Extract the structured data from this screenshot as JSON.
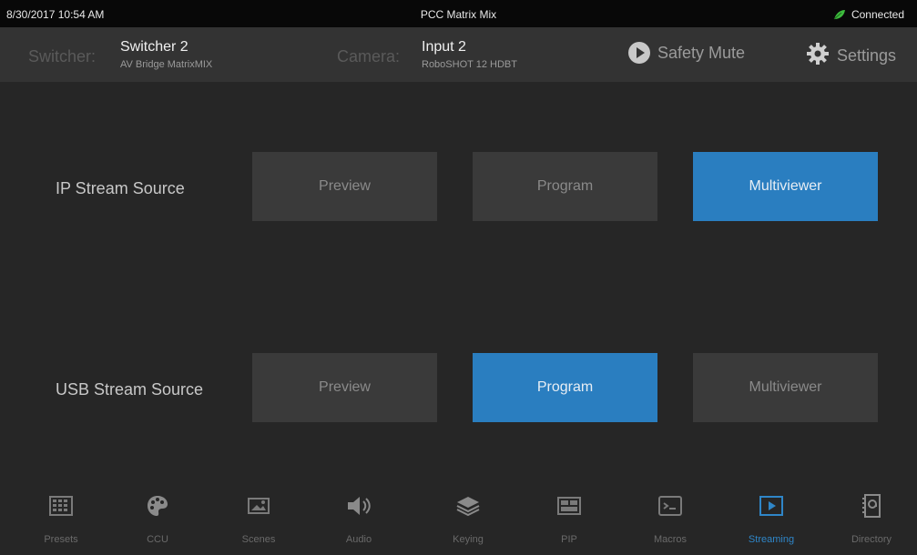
{
  "status": {
    "datetime": "8/30/2017 10:54 AM",
    "title": "PCC Matrix Mix",
    "connection": "Connected"
  },
  "header": {
    "switcher_label": "Switcher:",
    "switcher_name": "Switcher 2",
    "switcher_model": "AV Bridge MatrixMIX",
    "camera_label": "Camera:",
    "camera_name": "Input 2",
    "camera_model": "RoboSHOT 12 HDBT",
    "safety_mute": "Safety Mute",
    "settings": "Settings"
  },
  "rows": [
    {
      "label": "IP Stream Source",
      "options": [
        "Preview",
        "Program",
        "Multiviewer"
      ],
      "selected": "Multiviewer"
    },
    {
      "label": "USB Stream Source",
      "options": [
        "Preview",
        "Program",
        "Multiviewer"
      ],
      "selected": "Program"
    }
  ],
  "nav": [
    {
      "label": "Presets",
      "icon": "presets-grid-icon"
    },
    {
      "label": "CCU",
      "icon": "palette-icon"
    },
    {
      "label": "Scenes",
      "icon": "scenes-icon"
    },
    {
      "label": "Audio",
      "icon": "speaker-icon"
    },
    {
      "label": "Keying",
      "icon": "layers-icon"
    },
    {
      "label": "PIP",
      "icon": "pip-icon"
    },
    {
      "label": "Macros",
      "icon": "terminal-icon"
    },
    {
      "label": "Streaming",
      "icon": "streaming-icon"
    },
    {
      "label": "Directory",
      "icon": "directory-icon"
    }
  ],
  "active_nav": "Streaming",
  "colors": {
    "accent": "#2a7ec0",
    "connected": "#3dbb3d",
    "button_bg": "#3a3a3a",
    "header_bg": "#333333",
    "statusbar_bg": "#080808"
  }
}
